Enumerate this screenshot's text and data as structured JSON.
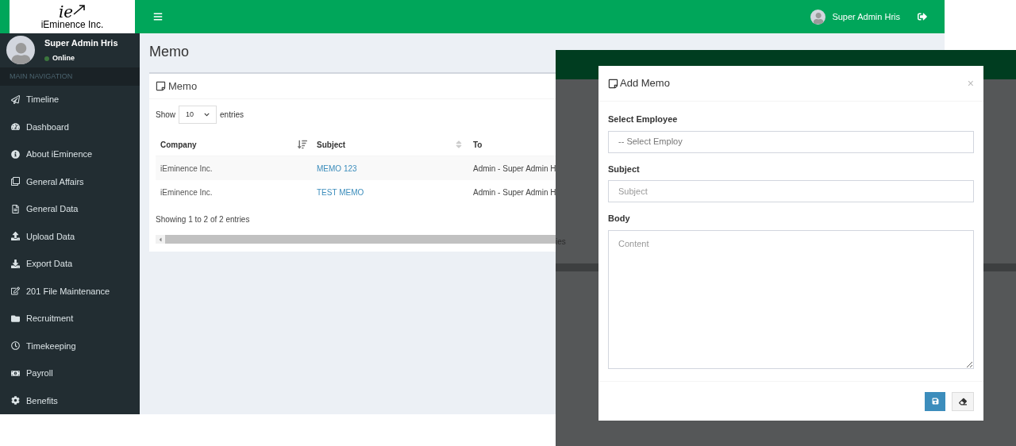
{
  "logo": {
    "mark": "ie",
    "name": "iEminence Inc."
  },
  "topbar": {
    "user_name": "Super Admin Hris"
  },
  "user_panel": {
    "name": "Super Admin Hris",
    "status": "Online"
  },
  "sidebar": {
    "header": "MAIN NAVIGATION",
    "items": [
      {
        "label": "Timeline"
      },
      {
        "label": "Dashboard"
      },
      {
        "label": "About iEminence"
      },
      {
        "label": "General Affairs"
      },
      {
        "label": "General Data"
      },
      {
        "label": "Upload Data"
      },
      {
        "label": "Export Data"
      },
      {
        "label": "201 File Maintenance"
      },
      {
        "label": "Recruitment"
      },
      {
        "label": "Timekeeping"
      },
      {
        "label": "Payroll"
      },
      {
        "label": "Benefits"
      }
    ]
  },
  "page": {
    "title": "Memo"
  },
  "memo_box": {
    "title": "Memo",
    "length": {
      "show": "Show",
      "value": "10",
      "entries": "entries"
    },
    "table": {
      "columns": [
        {
          "label": "Company",
          "sorted": true
        },
        {
          "label": "Subject",
          "sorted": false
        },
        {
          "label": "To"
        }
      ],
      "rows": [
        {
          "company": "iEminence Inc.",
          "subject": "MEMO 123",
          "to": "Admin - Super Admin H"
        },
        {
          "company": "iEminence Inc.",
          "subject": "TEST MEMO",
          "to": "Admin - Super Admin H"
        }
      ]
    },
    "info": "Showing 1 to 2 of 2 entries"
  },
  "overlay": {
    "background_text": "ies",
    "modal": {
      "title": "Add Memo",
      "close": "×",
      "fields": [
        {
          "kind": "select",
          "label": "Select Employee",
          "value": "-- Select Employ"
        },
        {
          "kind": "input",
          "label": "Subject",
          "placeholder": "Subject"
        },
        {
          "kind": "textarea",
          "label": "Body",
          "placeholder": "Content"
        }
      ]
    }
  }
}
